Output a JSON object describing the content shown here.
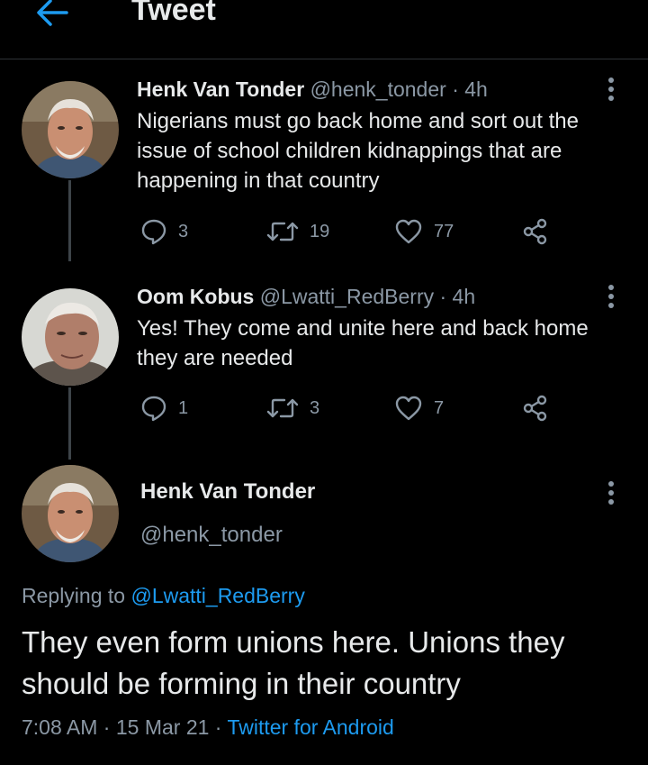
{
  "header": {
    "title": "Tweet",
    "back_icon": "back-arrow-icon",
    "accent": "#1d9bf0"
  },
  "thread": [
    {
      "name": "Henk Van Tonder",
      "handle": "@henk_tonder",
      "time": "· 4h",
      "text": "Nigerians must go back home and sort out the issue of school children kidnappings that are happening in that country",
      "replies": "3",
      "retweets": "19",
      "likes": "77"
    },
    {
      "name": "Oom Kobus",
      "handle": "@Lwatti_RedBerry",
      "time": "· 4h",
      "text": "Yes! They come and unite here and back home they are needed",
      "replies": "1",
      "retweets": "3",
      "likes": "7"
    }
  ],
  "main": {
    "name": "Henk Van Tonder",
    "handle": "@henk_tonder",
    "replying_prefix": "Replying to ",
    "replying_to": "@Lwatti_RedBerry",
    "text": "They even form unions here. Unions they should be forming in their country",
    "time": "7:08 AM",
    "date": "15 Mar 21",
    "source": "Twitter for Android"
  },
  "colors": {
    "background": "#000000",
    "text": "#e7e9ea",
    "muted": "#8b98a5",
    "link": "#1d9bf0"
  }
}
